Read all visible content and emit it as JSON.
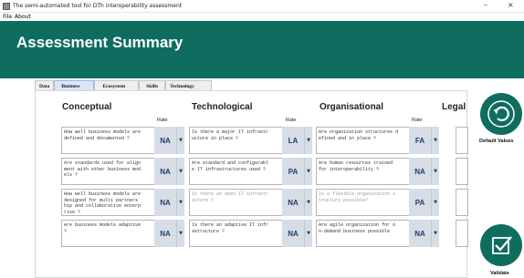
{
  "window": {
    "title": "The semi-automated tool for DTh interoperability assessment",
    "minimize": "–",
    "close": "×"
  },
  "menu": [
    "File",
    "About"
  ],
  "page_title": "Assessment Summary",
  "tabs": [
    "Data",
    "Business",
    "Ecosystem",
    "Skills",
    "Technology"
  ],
  "active_tab": "Business",
  "columns": {
    "conceptual": "Conceptual",
    "technological": "Technological",
    "organisational": "Organisational",
    "legal": "Legal"
  },
  "rate_label": "Rate",
  "rows": [
    {
      "conceptual": {
        "q": "How well business models are\ndefined and documented ?",
        "rate": "NA"
      },
      "technological": {
        "q": "Is there a major IT infrastr\nucture in place ?",
        "rate": "LA"
      },
      "organisational": {
        "q": "Are organization structures d\nefined and in place ?",
        "rate": "FA"
      }
    },
    {
      "conceptual": {
        "q": "Are standards used for align\nment with other business mod\nels ?",
        "rate": "NA"
      },
      "technological": {
        "q": "Are standard and configurabl\ne IT infrastructures used ?",
        "rate": "PA"
      },
      "organisational": {
        "q": "Are human resources trained\nfor interoperability ?",
        "rate": "NA"
      }
    },
    {
      "conceptual": {
        "q": "How well business models are\ndesigned for multi partners\nhip and collaborative enterp\nrise ?",
        "rate": "NA"
      },
      "technological": {
        "q": "Is there an open IT infrastr\nucture ?",
        "rate": "NA",
        "partial": true
      },
      "organisational": {
        "q": "Is a flexible organization s\ntructure possible?",
        "rate": "PA",
        "partial": true
      }
    },
    {
      "conceptual": {
        "q": "Are business models adaptive\n?",
        "rate": "NA"
      },
      "technological": {
        "q": "Is there an adaptive IT infr\nastructure ?",
        "rate": "NA"
      },
      "organisational": {
        "q": "Are agile organization for o\nn-demand business possible",
        "rate": "NA"
      }
    }
  ],
  "actions": {
    "default_values": "Default Values",
    "validate": "Validate"
  },
  "colors": {
    "header": "#0f6d5f",
    "rate_bg": "#d6dde6",
    "rate_text": "#1c3f6e"
  }
}
